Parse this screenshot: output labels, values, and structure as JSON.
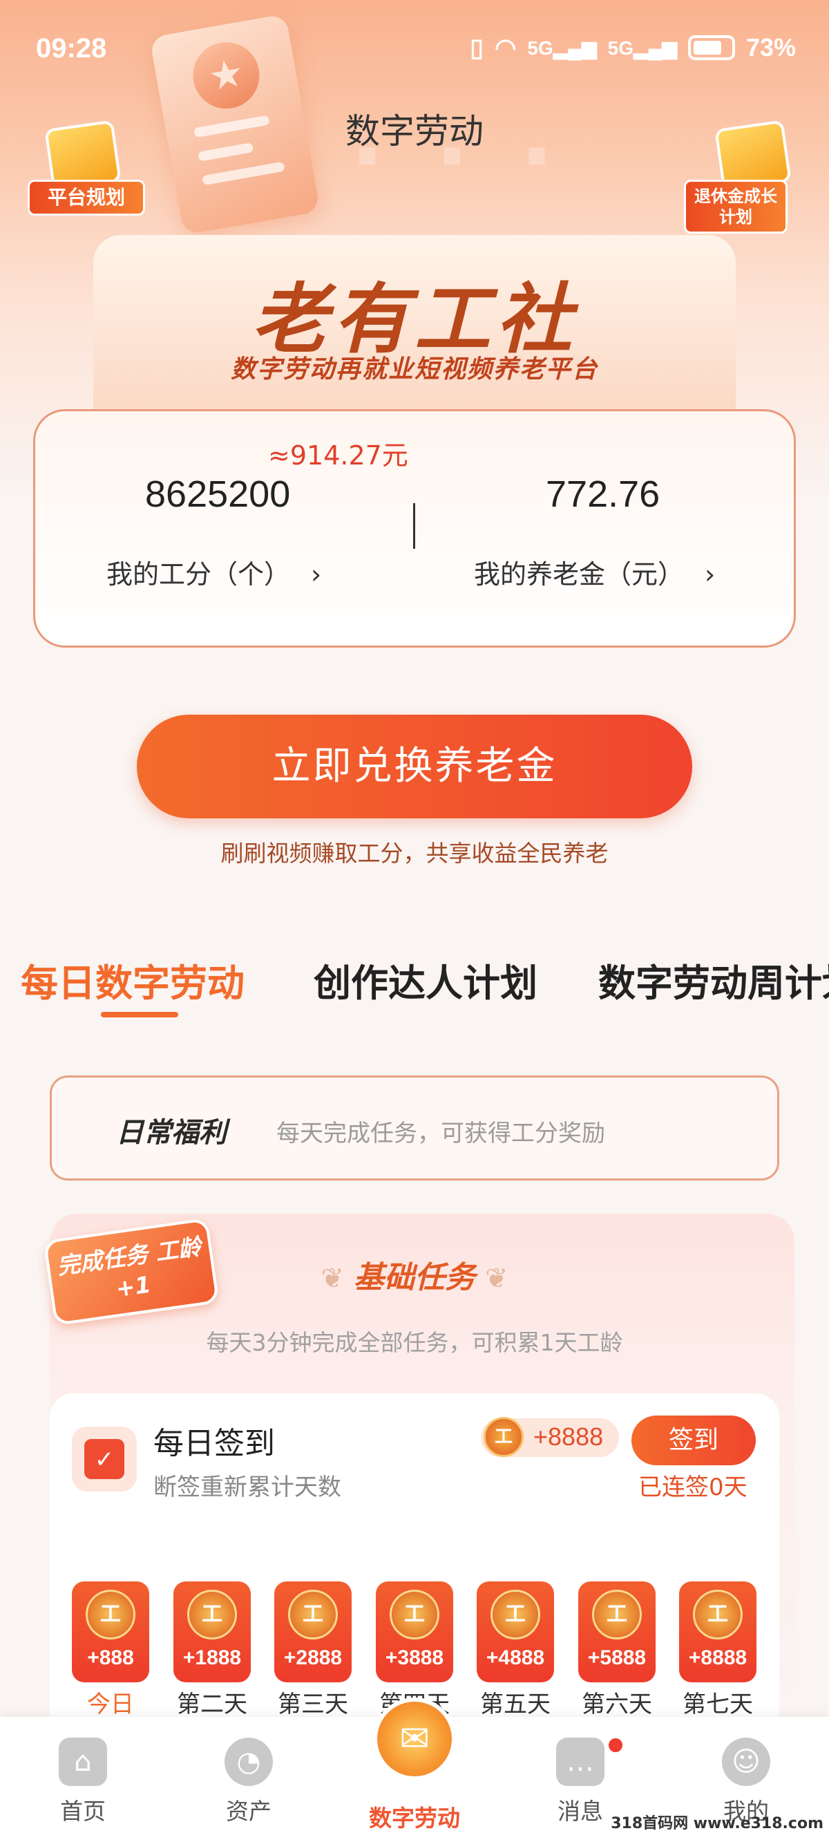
{
  "status_bar": {
    "time": "09:28",
    "signal1": "5G",
    "signal2": "5G",
    "battery": "73%"
  },
  "header": {
    "title": "数字劳动",
    "left_badge": "平台规划",
    "right_badge": "退休金成长计划"
  },
  "brand": {
    "title": "老有工社",
    "subtitle": "数字劳动再就业短视频养老平台"
  },
  "stats": {
    "approx_value": "≈914.27元",
    "work_points_value": "8625200",
    "work_points_label": "我的工分（个）",
    "pension_value": "772.76",
    "pension_label": "我的养老金（元）"
  },
  "exchange": {
    "button_label": "立即兑换养老金",
    "tagline": "刷刷视频赚取工分，共享收益全民养老"
  },
  "tabs": [
    {
      "label": "每日数字劳动",
      "active": true
    },
    {
      "label": "创作达人计划",
      "active": false
    },
    {
      "label": "数字劳动周计划",
      "active": false
    }
  ],
  "welfare": {
    "title": "日常福利",
    "desc": "每天完成任务，可获得工分奖励"
  },
  "basic_task": {
    "ribbon": "完成任务 工龄+1",
    "title": "基础任务",
    "desc": "每天3分钟完成全部任务，可积累1天工龄"
  },
  "checkin": {
    "title": "每日签到",
    "subtitle": "断签重新累计天数",
    "reward": "+8888",
    "button_label": "签到",
    "streak": "已连签0天",
    "days": [
      {
        "amount": "+888",
        "label": "今日"
      },
      {
        "amount": "+1888",
        "label": "第二天"
      },
      {
        "amount": "+2888",
        "label": "第三天"
      },
      {
        "amount": "+3888",
        "label": "第四天"
      },
      {
        "amount": "+4888",
        "label": "第五天"
      },
      {
        "amount": "+5888",
        "label": "第六天"
      },
      {
        "amount": "+8888",
        "label": "第七天"
      }
    ]
  },
  "bottom_nav": [
    {
      "label": "首页",
      "icon": "home-icon"
    },
    {
      "label": "资产",
      "icon": "pie-chart-icon"
    },
    {
      "label": "数字劳动",
      "icon": "scroll-icon"
    },
    {
      "label": "消息",
      "icon": "message-icon"
    },
    {
      "label": "我的",
      "icon": "user-icon"
    }
  ],
  "watermark": "318首码网 www.e318.com",
  "colors": {
    "accent": "#f26a2c",
    "button": "#f0452e",
    "brand_text": "#b8471a"
  }
}
